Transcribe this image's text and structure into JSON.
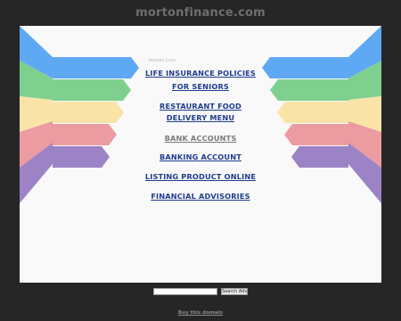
{
  "header": {
    "domain": "mortonfinance.com"
  },
  "related": {
    "label": "Related Links"
  },
  "links": [
    {
      "lines": [
        "LIFE INSURANCE POLICIES",
        "FOR SENIORS"
      ],
      "visited": false
    },
    {
      "lines": [
        "RESTAURANT FOOD",
        "DELIVERY MENU"
      ],
      "visited": false
    },
    {
      "lines": [
        "BANK ACCOUNTS"
      ],
      "visited": true
    },
    {
      "lines": [
        "BANKING ACCOUNT"
      ],
      "visited": false
    },
    {
      "lines": [
        "LISTING PRODUCT ONLINE"
      ],
      "visited": false
    },
    {
      "lines": [
        "FINANCIAL ADVISORIES"
      ],
      "visited": false
    }
  ],
  "search": {
    "value": "",
    "button_label": "Search Ads"
  },
  "footer": {
    "buy_label": "Buy this domain"
  },
  "colors": {
    "background": "#262626",
    "panel": "#f9f9f9",
    "link": "#1f3c8f",
    "link_visited": "#7a7a7a",
    "ribbons": [
      "#5fa8f4",
      "#7fd08f",
      "#f9e3a6",
      "#ec9ba1",
      "#9b83c5"
    ]
  }
}
